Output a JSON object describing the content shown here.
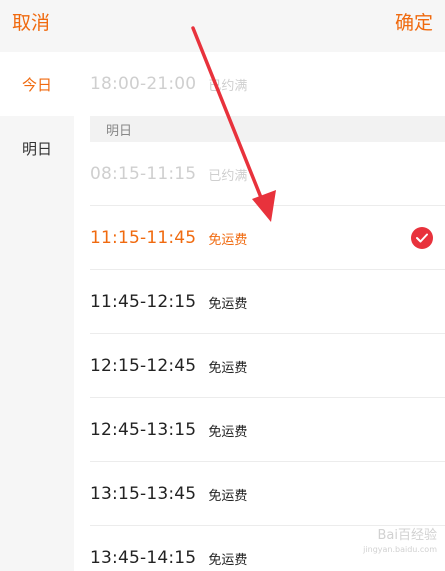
{
  "header": {
    "cancel_label": "取消",
    "confirm_label": "确定"
  },
  "sidebar": {
    "items": [
      {
        "label": "今日"
      },
      {
        "label": "明日"
      }
    ]
  },
  "content": {
    "date_header": "明日",
    "slots": [
      {
        "time": "18:00-21:00",
        "tag": "已约满"
      },
      {
        "time": "08:15-11:15",
        "tag": "已约满"
      },
      {
        "time": "11:15-11:45",
        "tag": "免运费"
      },
      {
        "time": "11:45-12:15",
        "tag": "免运费"
      },
      {
        "time": "12:15-12:45",
        "tag": "免运费"
      },
      {
        "time": "12:45-13:15",
        "tag": "免运费"
      },
      {
        "time": "13:15-13:45",
        "tag": "免运费"
      },
      {
        "time": "13:45-14:15",
        "tag": "免运费"
      }
    ]
  },
  "watermark": {
    "brand": "Bai百经验",
    "url": "jingyan.baidu.com"
  },
  "colors": {
    "accent": "#f06a0f",
    "check": "#e8323c",
    "annotation_arrow": "#e8323c"
  },
  "icons": {
    "selected": "check-icon"
  }
}
